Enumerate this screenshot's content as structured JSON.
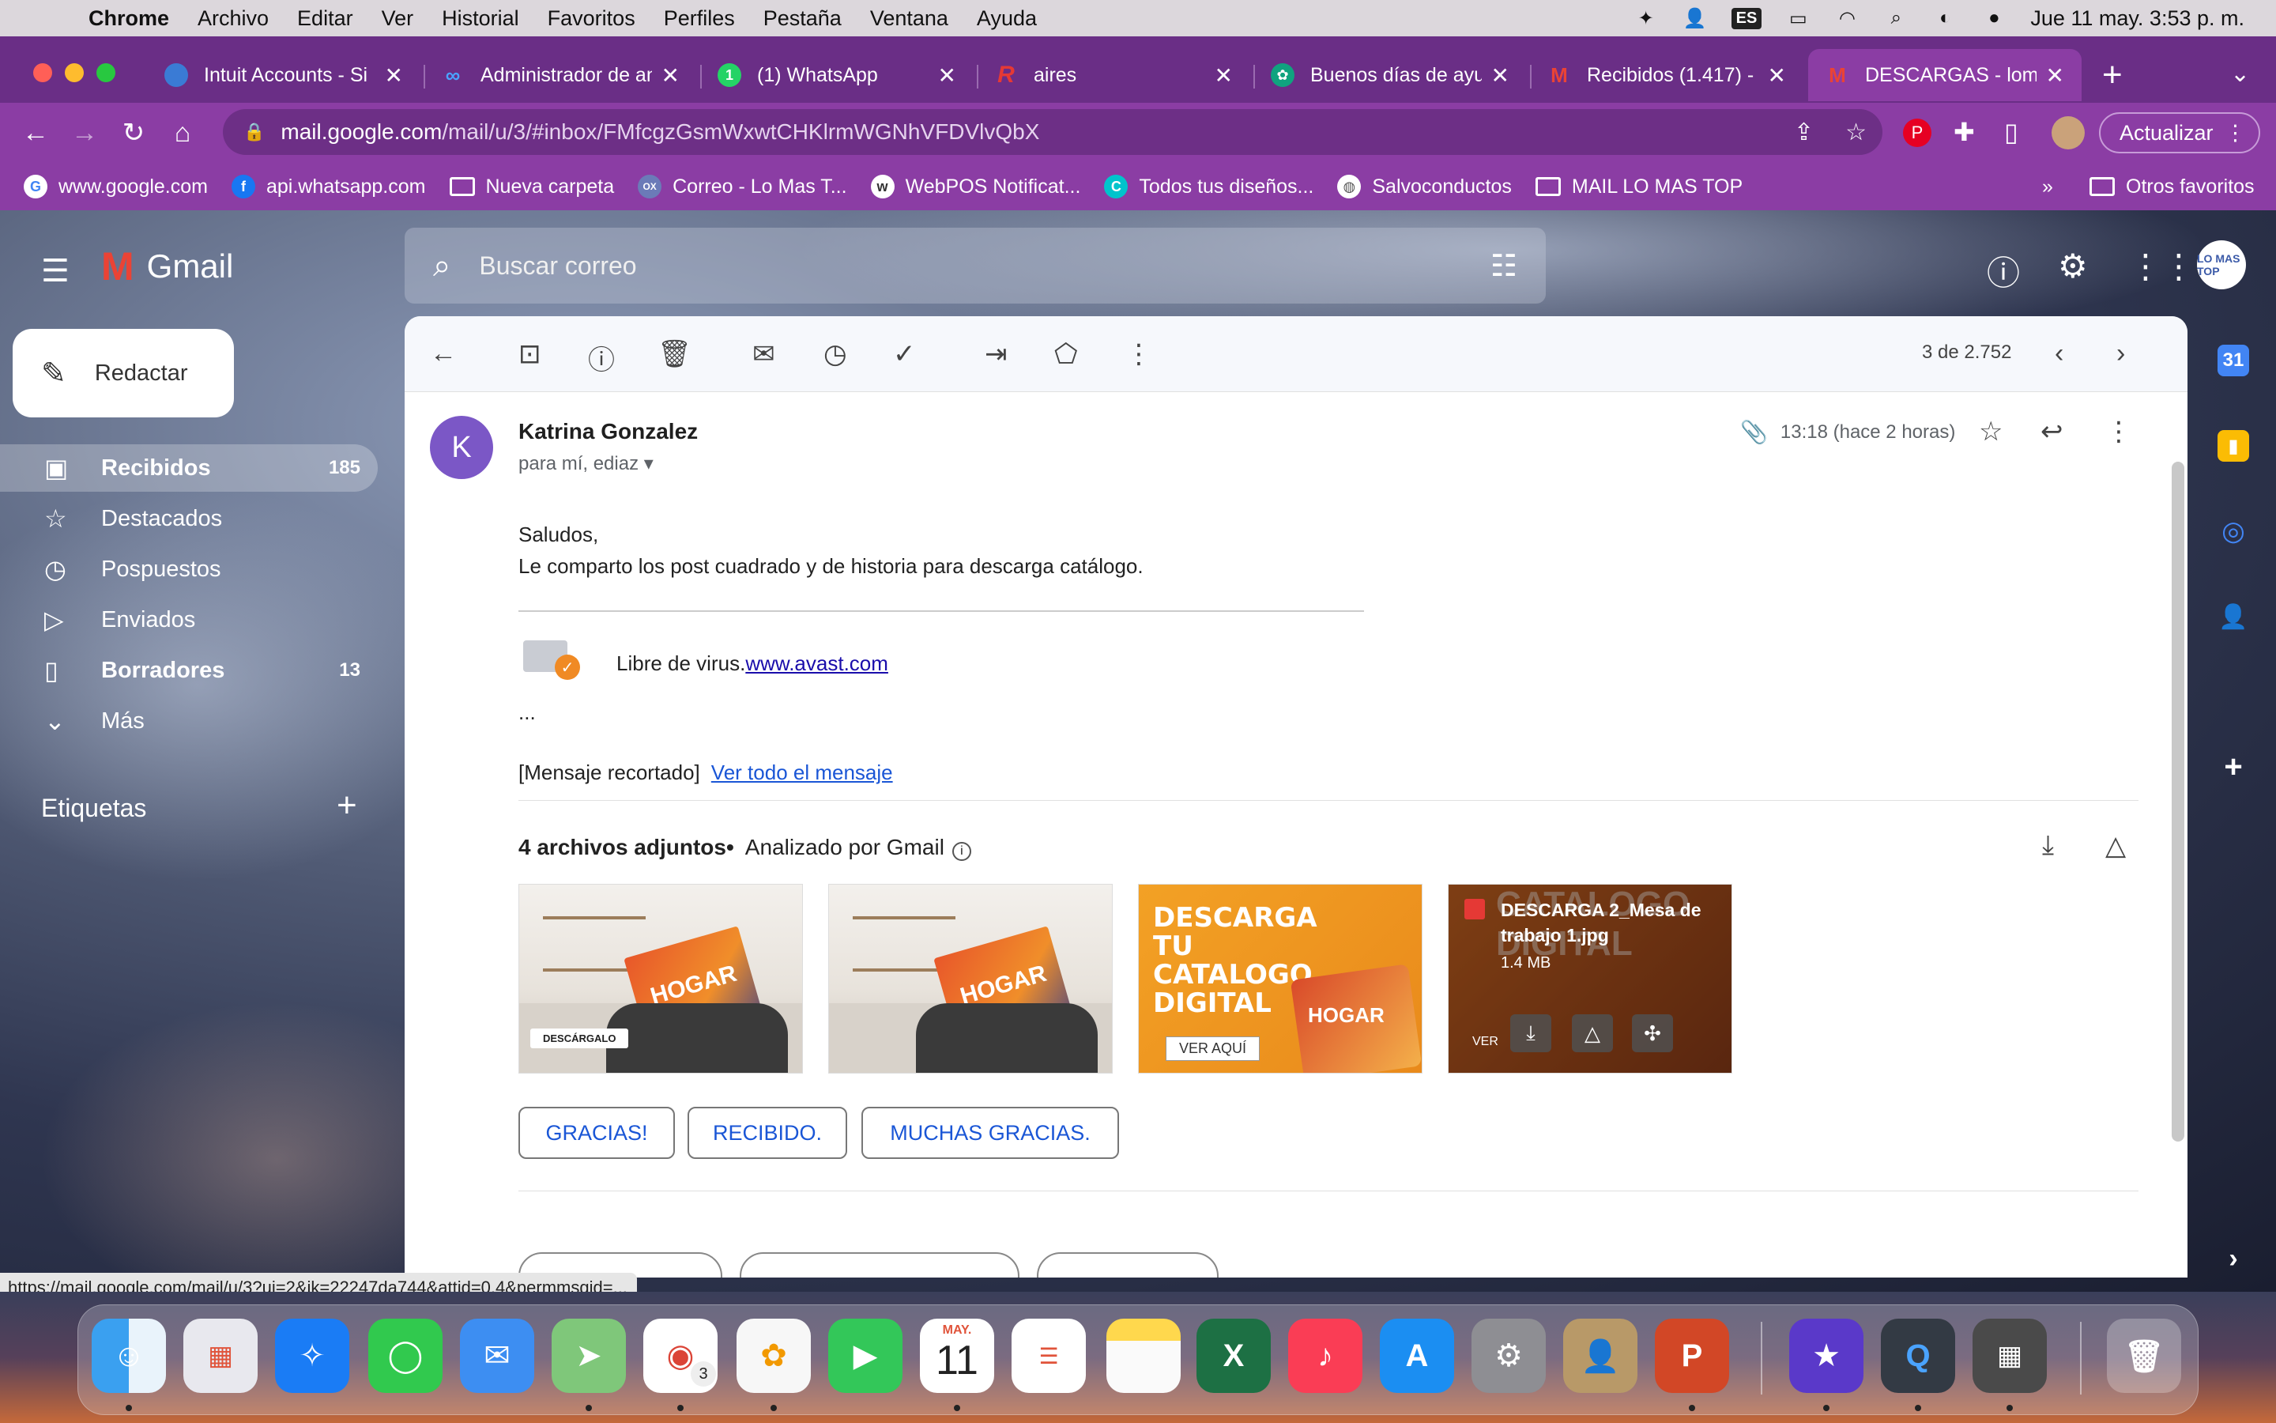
{
  "menubar": {
    "app": "Chrome",
    "items": [
      "Archivo",
      "Editar",
      "Ver",
      "Historial",
      "Favoritos",
      "Perfiles",
      "Pestaña",
      "Ventana",
      "Ayuda"
    ],
    "input_lang": "ES",
    "datetime": "Jue 11 may.  3:53 p. m."
  },
  "tabs": [
    {
      "title": "Intuit Accounts - Si",
      "favicon": "globe-icon"
    },
    {
      "title": "Administrador de an",
      "favicon": "meta-icon"
    },
    {
      "title": "(1) WhatsApp",
      "favicon": "whatsapp-icon"
    },
    {
      "title": "aires",
      "favicon": "r-icon"
    },
    {
      "title": "Buenos días de ayu",
      "favicon": "openai-icon"
    },
    {
      "title": "Recibidos (1.417) -",
      "favicon": "gmail-icon"
    },
    {
      "title": "DESCARGAS - loma",
      "favicon": "gmail-icon",
      "active": true
    }
  ],
  "url": {
    "host": "mail.google.com",
    "path": "/mail/u/3/#inbox/FMfcgzGsmWxwtCHKlrmWGNhVFDVlvQbX"
  },
  "update_button": "Actualizar",
  "bookmarks": [
    {
      "label": "www.google.com",
      "icon": "google-icon"
    },
    {
      "label": "api.whatsapp.com",
      "icon": "facebook-icon"
    },
    {
      "label": "Nueva carpeta",
      "icon": "folder-icon"
    },
    {
      "label": "Correo - Lo Mas T...",
      "icon": "outlook-icon"
    },
    {
      "label": "WebPOS Notificat...",
      "icon": "webpos-icon"
    },
    {
      "label": "Todos tus diseños...",
      "icon": "canva-icon"
    },
    {
      "label": "Salvoconductos",
      "icon": "globe-icon"
    },
    {
      "label": "MAIL LO MAS TOP",
      "icon": "folder-icon"
    }
  ],
  "bookmarks_more": "»",
  "other_bookmarks": "Otros favoritos",
  "gmail": {
    "logo": "Gmail",
    "search_placeholder": "Buscar correo",
    "compose": "Redactar",
    "nav": [
      {
        "label": "Recibidos",
        "count": "185",
        "icon": "inbox-icon"
      },
      {
        "label": "Destacados",
        "count": "",
        "icon": "star-icon"
      },
      {
        "label": "Pospuestos",
        "count": "",
        "icon": "clock-icon"
      },
      {
        "label": "Enviados",
        "count": "",
        "icon": "send-icon"
      },
      {
        "label": "Borradores",
        "count": "13",
        "icon": "draft-icon"
      },
      {
        "label": "Más",
        "count": "",
        "icon": "chevron-down-icon"
      }
    ],
    "labels_title": "Etiquetas",
    "pager": "3 de 2.752",
    "avatar_text": "LO MAS TOP"
  },
  "message": {
    "sender_initial": "K",
    "sender": "Katrina Gonzalez",
    "recipients": "para mí, ediaz",
    "time": "13:18 (hace 2 horas)",
    "greeting": "Saludos,",
    "body": "Le comparto los post cuadrado y de historia para descarga catálogo.",
    "avast_text": "Libre de virus.",
    "avast_link": "www.avast.com",
    "ellipsis": "...",
    "trimmed": "[Mensaje recortado]",
    "view_all": "Ver todo el mensaje",
    "attachments_title": "4 archivos adjuntos",
    "scanned": "Analizado por Gmail",
    "attachments": [
      {
        "pill": "DESCÁRGALO",
        "brand": "HOGAR"
      },
      {
        "brand": "HOGAR"
      },
      {
        "headline": "DESCARGA TU CATALOGO DIGITAL",
        "cta": "VER AQUÍ",
        "brand": "HOGAR"
      },
      {
        "filename": "DESCARGA 2_Mesa de trabajo 1.jpg",
        "size": "1.4 MB",
        "bg_text": "CATALOGO DIGITAL",
        "ver": "VER"
      }
    ],
    "quick_replies": [
      "GRACIAS!",
      "RECIBIDO.",
      "MUCHAS GRACIAS."
    ]
  },
  "status_url": "https://mail.google.com/mail/u/3?ui=2&ik=22247da744&attid=0.4&permmsgid=...",
  "dock": {
    "calendar_month": "MAY.",
    "calendar_day": "11",
    "chrome_badge": "3",
    "apps": [
      "finder-icon",
      "launchpad-icon",
      "safari-icon",
      "messages-icon",
      "mail-icon",
      "maps-icon",
      "chrome-icon",
      "photos-icon",
      "facetime-icon",
      "calendar-icon",
      "reminders-icon",
      "notes-icon",
      "excel-icon",
      "music-icon",
      "appstore-icon",
      "settings-icon",
      "contacts-icon",
      "powerpoint-icon",
      "imovie-icon",
      "quicktime-icon",
      "calculator-icon",
      "trash-icon"
    ]
  }
}
